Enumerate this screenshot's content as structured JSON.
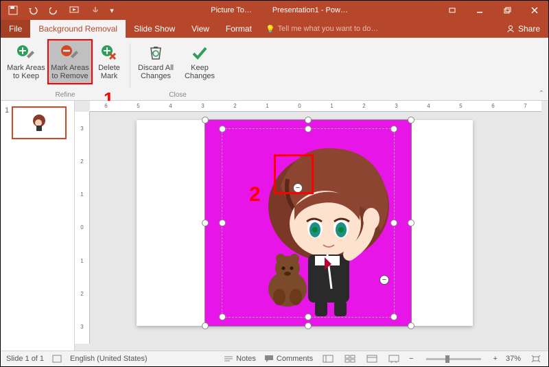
{
  "titlebar": {
    "picture_tools": "Picture To…",
    "app_title": "Presentation1 - Pow…"
  },
  "tabs": {
    "file": "File",
    "bg_removal": "Background Removal",
    "slide_show": "Slide Show",
    "view": "View",
    "format": "Format",
    "tell_me": "Tell me what you want to do…",
    "share": "Share"
  },
  "ribbon": {
    "refine": {
      "keep": "Mark Areas to Keep",
      "remove": "Mark Areas to Remove",
      "delete": "Delete Mark",
      "label": "Refine"
    },
    "close": {
      "discard": "Discard All Changes",
      "keep": "Keep Changes",
      "label": "Close"
    }
  },
  "annotations": {
    "one": "1",
    "two": "2"
  },
  "slides": {
    "thumb_num": "1"
  },
  "ruler_h": [
    "6",
    "5",
    "4",
    "3",
    "2",
    "1",
    "0",
    "1",
    "2",
    "3",
    "4",
    "5",
    "6",
    "7"
  ],
  "ruler_v": [
    "3",
    "2",
    "1",
    "0",
    "1",
    "2",
    "3"
  ],
  "statusbar": {
    "slide": "Slide 1 of 1",
    "lang": "English (United States)",
    "notes": "Notes",
    "comments": "Comments",
    "zoom": "37%"
  }
}
